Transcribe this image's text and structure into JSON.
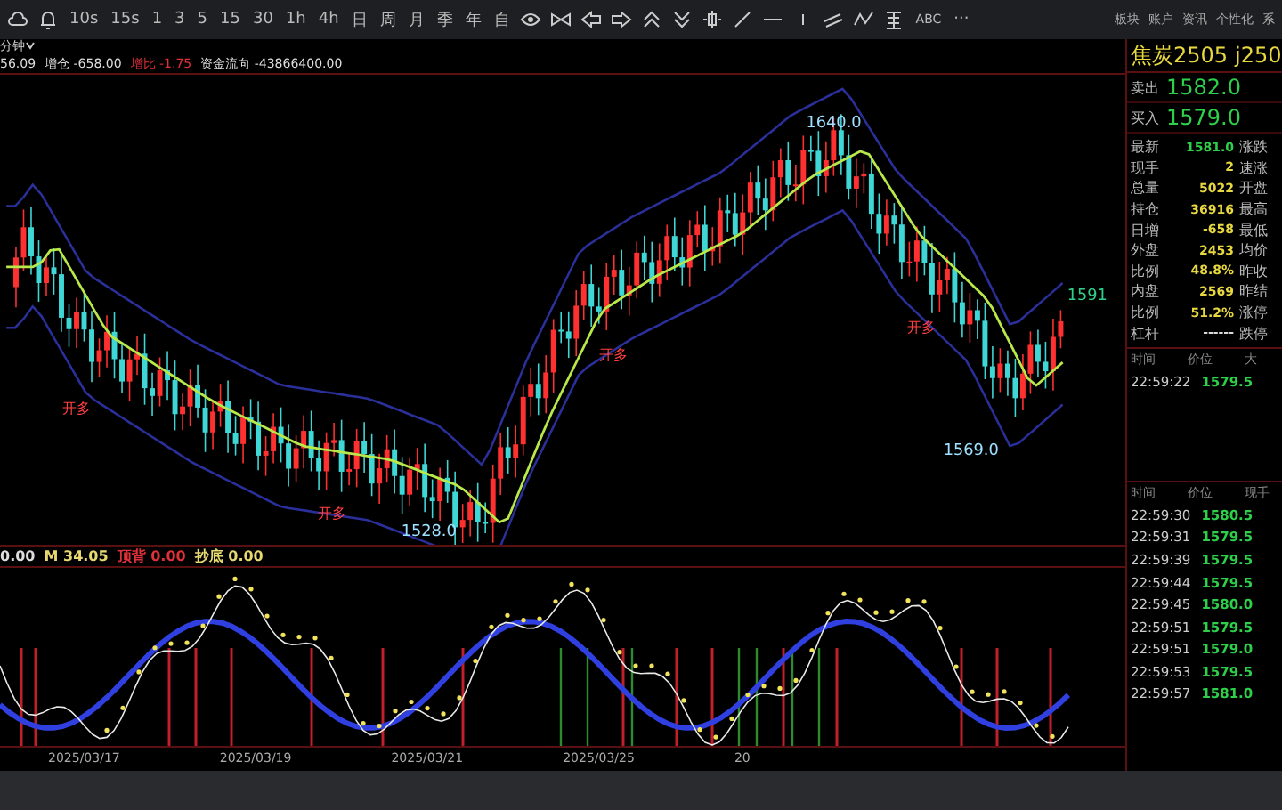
{
  "toolbar": {
    "periods": [
      {
        "label": "10s",
        "selected": false
      },
      {
        "label": "15s",
        "selected": false
      },
      {
        "label": "1",
        "selected": false
      },
      {
        "label": "3",
        "selected": false
      },
      {
        "label": "5",
        "selected": false
      },
      {
        "label": "15",
        "selected": false
      },
      {
        "label": "30",
        "selected": false
      },
      {
        "label": "1h",
        "selected": false
      },
      {
        "label": "4h",
        "selected": false
      },
      {
        "label": "日",
        "selected": false
      },
      {
        "label": "周",
        "selected": false
      },
      {
        "label": "月",
        "selected": false
      },
      {
        "label": "季",
        "selected": false
      },
      {
        "label": "年",
        "selected": false
      },
      {
        "label": "自",
        "selected": false
      }
    ],
    "text_tool": "ABC",
    "more": "···",
    "menu": [
      "板块",
      "账户",
      "资讯",
      "个性化",
      "系"
    ]
  },
  "chart": {
    "period": "分钟",
    "stats": [
      {
        "text": "56.09",
        "color": "#dddddd"
      },
      {
        "text": "增仓 -658.00",
        "color": "#dddddd"
      },
      {
        "text": "增比 -1.75",
        "color": "#e0303a"
      },
      {
        "text": "资金流向 -43866400.00",
        "color": "#dddddd"
      }
    ],
    "labels": [
      {
        "text": "1640.0",
        "kind": "price"
      },
      {
        "text": "1528.0",
        "kind": "price"
      },
      {
        "text": "1569.0",
        "kind": "price"
      },
      {
        "text": "1591",
        "kind": "last"
      },
      {
        "text": "开多",
        "kind": "signal"
      },
      {
        "text": "开多",
        "kind": "signal"
      },
      {
        "text": "开多",
        "kind": "signal"
      },
      {
        "text": "开多",
        "kind": "signal"
      }
    ],
    "indicators": [
      {
        "text": "0.00",
        "kind": "base"
      },
      {
        "text": "M 34.05",
        "kind": "average"
      },
      {
        "text": "顶背 0.00",
        "kind": "top"
      },
      {
        "text": "抄底 0.00",
        "kind": "bottom"
      }
    ],
    "dates": [
      "2025/03/17",
      "2025/03/19",
      "2025/03/21",
      "2025/03/25",
      "20"
    ]
  },
  "quote": {
    "name": "焦炭2505",
    "code": "j250",
    "sell_label": "卖出",
    "sell": "1582.0",
    "buy_label": "买入",
    "buy": "1579.0",
    "rows": [
      {
        "label": "最新",
        "value": "1581.0",
        "color": "#2ed04a",
        "right": "涨跌"
      },
      {
        "label": "现手",
        "value": "2",
        "color": "#e8d840",
        "right": "速涨"
      },
      {
        "label": "总量",
        "value": "5022",
        "color": "#e8d840",
        "right": "开盘"
      },
      {
        "label": "持仓",
        "value": "36916",
        "color": "#e8d840",
        "right": "最高"
      },
      {
        "label": "日增",
        "value": "-658",
        "color": "#e8d840",
        "right": "最低"
      },
      {
        "label": "外盘",
        "value": "2453",
        "color": "#e8d840",
        "right": "均价"
      },
      {
        "label": "比例",
        "value": "48.8%",
        "color": "#e8d840",
        "right": "昨收"
      },
      {
        "label": "内盘",
        "value": "2569",
        "color": "#e8d840",
        "right": "昨结"
      },
      {
        "label": "比例",
        "value": "51.2%",
        "color": "#e8d840",
        "right": "涨停"
      },
      {
        "label": "杠杆",
        "value": "------",
        "color": "#dddddd",
        "right": "跌停"
      }
    ]
  },
  "ticks_top": {
    "columns": [
      "时间",
      "价位",
      "大"
    ],
    "rows": [
      {
        "time": "22:59:22",
        "price": "1579.5"
      }
    ]
  },
  "ticks": {
    "columns": [
      "时间",
      "价位",
      "现手"
    ],
    "rows": [
      {
        "time": "22:59:30",
        "price": "1580.5"
      },
      {
        "time": "22:59:31",
        "price": "1579.5"
      },
      {
        "time": "22:59:39",
        "price": "1579.5"
      },
      {
        "time": "22:59:44",
        "price": "1579.5"
      },
      {
        "time": "22:59:45",
        "price": "1580.0"
      },
      {
        "time": "22:59:51",
        "price": "1579.5"
      },
      {
        "time": "22:59:51",
        "price": "1579.0"
      },
      {
        "time": "22:59:53",
        "price": "1579.5"
      },
      {
        "time": "22:59:57",
        "price": "1581.0"
      }
    ]
  }
}
